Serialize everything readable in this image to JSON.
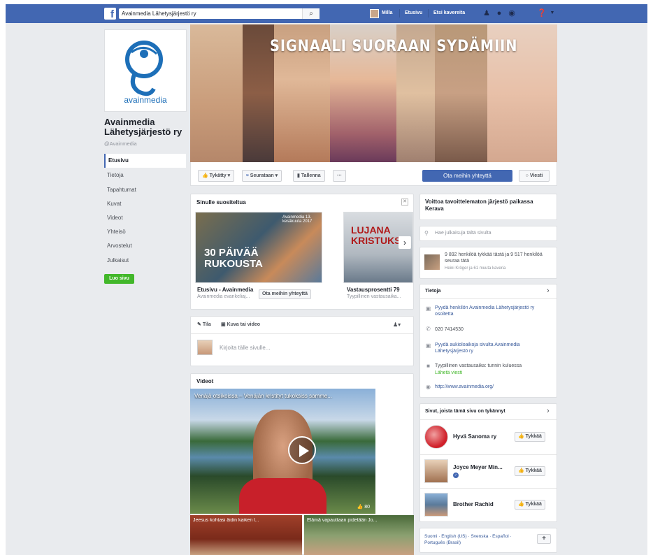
{
  "topbar": {
    "search_value": "Avainmedia Lähetysjärjestö ry",
    "user_name": "Milla",
    "home_label": "Etusivu",
    "find_friends_label": "Etsi kavereita"
  },
  "page": {
    "logo_text": "avainmedia",
    "name": "Avainmedia Lähetysjärjestö ry",
    "handle": "@Avainmedia",
    "cover_title": "SIGNAALI SUORAAN SYDÄMIIN"
  },
  "nav": [
    "Etusivu",
    "Tietoja",
    "Tapahtumat",
    "Kuvat",
    "Videot",
    "Yhteisö",
    "Arvostelut",
    "Julkaisut"
  ],
  "create_page_label": "Luo sivu",
  "actions": {
    "liked": "Tykätty",
    "following": "Seurataan",
    "save": "Tallenna",
    "more": "···",
    "contact": "Ota meihin yhteyttä",
    "message": "Viesti"
  },
  "recommended": {
    "title": "Sinulle suositeltua",
    "card1_img_title": "30 PÄIVÄÄ RUKOUSTA",
    "card1_overlay": "Avainmedia 13. kesäkuuta 2017",
    "card1_name": "Etusivu - Avainmedia",
    "card1_desc": "Avainmedia evankeliaj...",
    "card1_button": "Ota meihin yhteyttä",
    "card2_img_title": "LUJANA KRISTUKSE",
    "card2_name": "Vastausprosentti 79",
    "card2_desc": "Tyypillinen vastausaika..."
  },
  "composer": {
    "post_label": "Tila",
    "photo_label": "Kuva tai video",
    "placeholder": "Kirjoita tälle sivulle..."
  },
  "videos": {
    "title": "Videot",
    "main_caption": "Venäjä otsikoissa – Venäjän kristityt tukoksiss samme...",
    "likes": "80",
    "thumb1_caption": "Jeesus kohtasi äidin kaiken l...",
    "thumb2_caption": "Elämä vapauttaan pidetään Jo..."
  },
  "right": {
    "nonprofit": "Voittoa tavoittelematon järjestö paikassa Kerava",
    "search_placeholder": "Hae julkaisuja tältä sivulta",
    "likes_text": "9 892 henkilöä tykkää tästä ja 9 517 henkilöä seuraa tätä",
    "likes_friends": "Heini Kröger ja 61 muuta kaveria",
    "about_title": "Tietoja",
    "about_address": "Pyydä henkilön Avainmedia Lähetysjärjestö ry osoitetta",
    "about_phone": "020 7414530",
    "about_hours": "Pyydä aukioloaikoja sivulta Avainmedia Lähetysjärjestö ry",
    "about_response": "Tyypillinen vastausaika: tunnin kuluessa",
    "about_send": "Lähetä viesti",
    "about_web": "http://www.avainmedia.org/",
    "liked_pages_title": "Sivut, joista tämä sivu on tykännyt",
    "liked_pages": [
      {
        "name": "Hyvä Sanoma ry"
      },
      {
        "name": "Joyce Meyer Min..."
      },
      {
        "name": "Brother Rachid"
      }
    ],
    "like_button": "Tykkää",
    "languages": "Suomi · English (US) · Svenska · Español · Português (Brasil)"
  }
}
